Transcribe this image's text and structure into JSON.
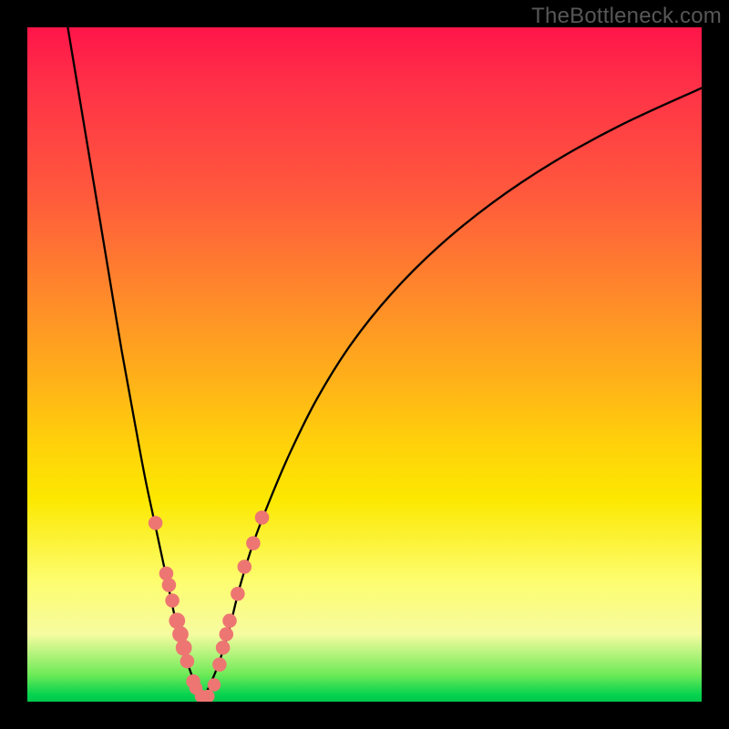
{
  "watermark": "TheBottleneck.com",
  "chart_data": {
    "type": "line",
    "title": "",
    "xlabel": "",
    "ylabel": "",
    "xlim": [
      0,
      100
    ],
    "ylim": [
      0,
      100
    ],
    "series": [
      {
        "name": "left-branch",
        "x": [
          6,
          8,
          10,
          12,
          14,
          16,
          17.5,
          19,
          20.5,
          22,
          23,
          24,
          25,
          26
        ],
        "y": [
          100,
          88,
          76,
          64,
          52,
          41,
          33,
          26,
          19,
          12,
          8,
          5,
          2.3,
          0.5
        ]
      },
      {
        "name": "right-branch",
        "x": [
          26,
          27,
          28.5,
          30,
          31.5,
          33.5,
          36,
          39,
          43,
          48,
          54,
          61,
          69,
          78,
          88,
          100
        ],
        "y": [
          0.5,
          2.3,
          6,
          11,
          17,
          23.5,
          30,
          37,
          45,
          53,
          60.5,
          67.5,
          74,
          80,
          85.5,
          91
        ]
      }
    ],
    "dots": {
      "name": "markers",
      "points": [
        {
          "x": 19.0,
          "y": 26.5,
          "r": 1.4
        },
        {
          "x": 20.6,
          "y": 19.0,
          "r": 1.4
        },
        {
          "x": 21.0,
          "y": 17.3,
          "r": 1.4
        },
        {
          "x": 21.5,
          "y": 15.0,
          "r": 1.4
        },
        {
          "x": 22.2,
          "y": 12.0,
          "r": 1.6
        },
        {
          "x": 22.7,
          "y": 10.0,
          "r": 1.6
        },
        {
          "x": 23.2,
          "y": 8.0,
          "r": 1.6
        },
        {
          "x": 23.7,
          "y": 6.0,
          "r": 1.4
        },
        {
          "x": 24.6,
          "y": 3.0,
          "r": 1.4
        },
        {
          "x": 25.0,
          "y": 2.0,
          "r": 1.3
        },
        {
          "x": 25.8,
          "y": 0.8,
          "r": 1.3
        },
        {
          "x": 26.8,
          "y": 0.8,
          "r": 1.3
        },
        {
          "x": 27.7,
          "y": 2.5,
          "r": 1.3
        },
        {
          "x": 28.5,
          "y": 5.5,
          "r": 1.4
        },
        {
          "x": 29.0,
          "y": 8.0,
          "r": 1.4
        },
        {
          "x": 29.5,
          "y": 10.0,
          "r": 1.4
        },
        {
          "x": 30.0,
          "y": 12.0,
          "r": 1.4
        },
        {
          "x": 31.2,
          "y": 16.0,
          "r": 1.4
        },
        {
          "x": 32.2,
          "y": 20.0,
          "r": 1.4
        },
        {
          "x": 33.5,
          "y": 23.5,
          "r": 1.4
        },
        {
          "x": 34.8,
          "y": 27.3,
          "r": 1.4
        }
      ]
    },
    "gradient_stops": [
      {
        "pos": 0,
        "color": "#ff1549"
      },
      {
        "pos": 25,
        "color": "#ff5a3c"
      },
      {
        "pos": 52,
        "color": "#ffb019"
      },
      {
        "pos": 70,
        "color": "#fce800"
      },
      {
        "pos": 90,
        "color": "#f6fca0"
      },
      {
        "pos": 99,
        "color": "#05d34f"
      },
      {
        "pos": 100,
        "color": "#03c64a"
      }
    ]
  }
}
